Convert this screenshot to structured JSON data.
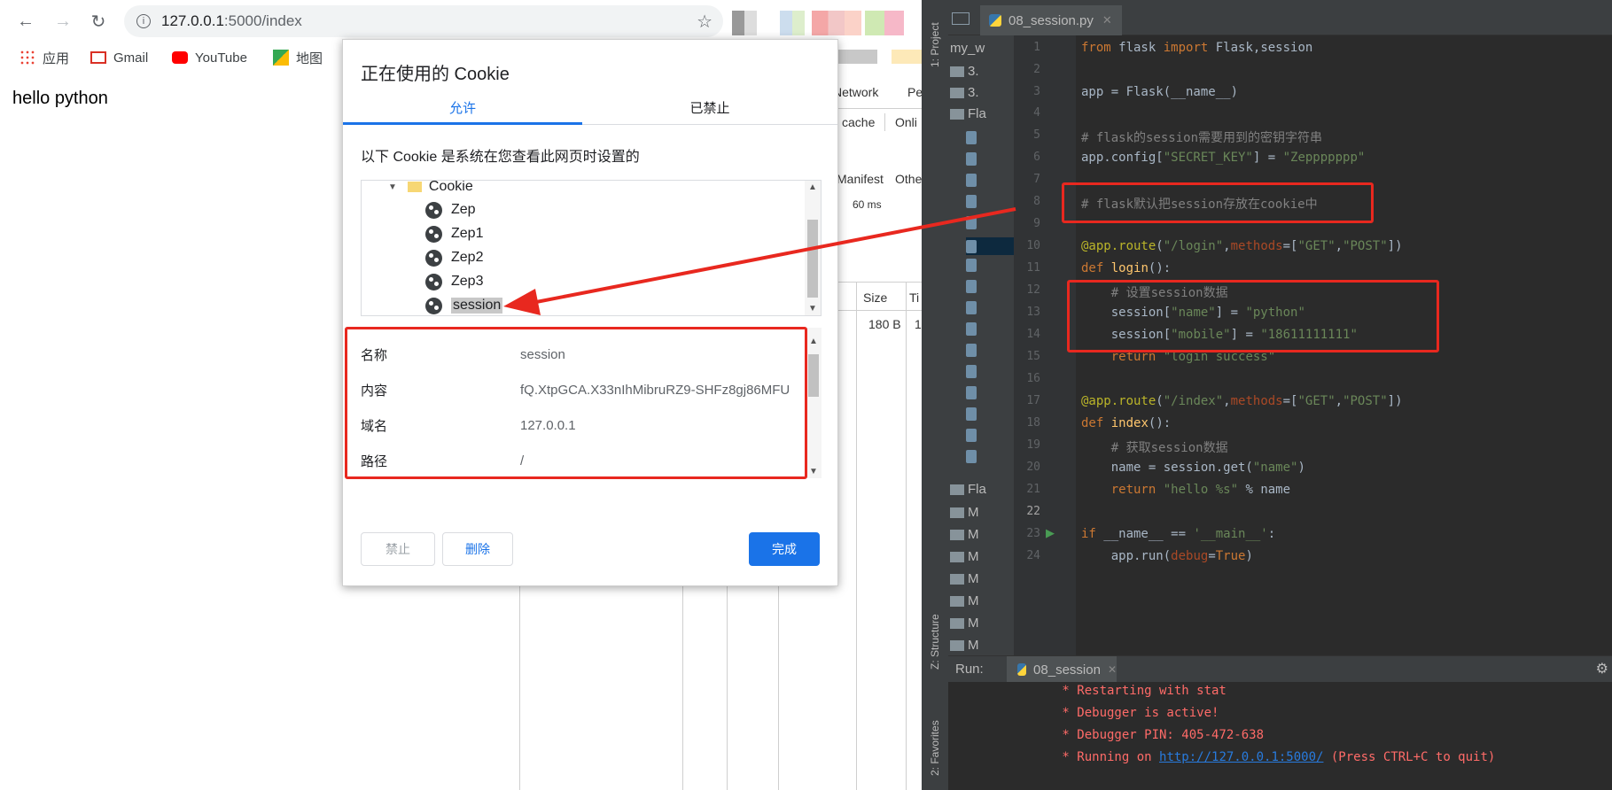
{
  "browser": {
    "url_host": "127.0.0.1",
    "url_path": ":5000/index",
    "bookmarks": [
      "应用",
      "Gmail",
      "YouTube",
      "地图"
    ],
    "page_text": "hello python"
  },
  "devtools": {
    "network_tab": "Network",
    "pe_tab": "Pe",
    "cache": "cache",
    "online": "Onli",
    "manifest": "Manifest",
    "other": "Othe",
    "time": "60 ms",
    "size_header": "Size",
    "t_header": "Ti",
    "size_value": "180 B",
    "t_value": "1"
  },
  "cookie_dialog": {
    "title": "正在使用的 Cookie",
    "tab_allowed": "允许",
    "tab_blocked": "已禁止",
    "description": "以下 Cookie 是系统在您查看此网页时设置的",
    "tree_folder": "Cookie",
    "tree_items": [
      "Zep",
      "Zep1",
      "Zep2",
      "Zep3",
      "session"
    ],
    "details": [
      {
        "key": "名称",
        "value": "session"
      },
      {
        "key": "内容",
        "value": "fQ.XtpGCA.X33nIhMibruRZ9-SHFz8gj86MFU"
      },
      {
        "key": "域名",
        "value": "127.0.0.1"
      },
      {
        "key": "路径",
        "value": "/"
      }
    ],
    "btn_block": "禁止",
    "btn_remove": "删除",
    "btn_done": "完成"
  },
  "ide": {
    "file_tab": "08_session.py",
    "project_label": "1: Project",
    "structure_label": "Z: Structure",
    "favorites_label": "2: Favorites",
    "project_rows": [
      "my_w",
      "3.",
      "3.",
      "Fla",
      "Fla",
      "M",
      "M",
      "M",
      "M",
      "M",
      "M",
      "M"
    ],
    "line_numbers": [
      "1",
      "2",
      "3",
      "4",
      "5",
      "6",
      "7",
      "8",
      "9",
      "10",
      "11",
      "12",
      "13",
      "14",
      "15",
      "16",
      "17",
      "18",
      "19",
      "20",
      "21",
      "22",
      "23",
      "24"
    ],
    "run_label": "Run:",
    "run_tab": "08_session",
    "console": [
      " * Restarting with stat",
      " * Debugger is active!",
      " * Debugger PIN: 405-472-638"
    ],
    "console_running_prefix": " * Running on ",
    "console_link": "http://127.0.0.1:5000/",
    "console_running_suffix": " (Press CTRL+C to quit)"
  },
  "colors": {
    "annotation_red": "#e8281f",
    "chrome_blue": "#1a73e8",
    "ide_bg": "#2b2b2b"
  }
}
